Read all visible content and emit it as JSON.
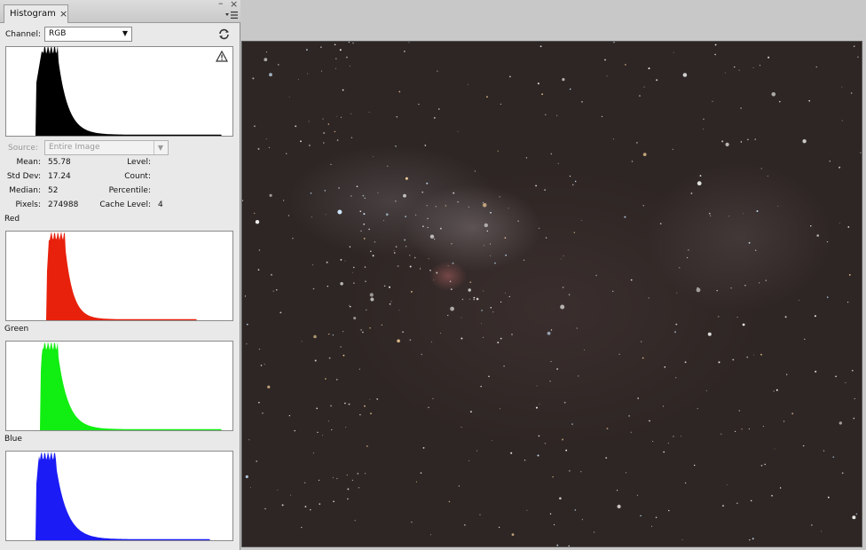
{
  "panel": {
    "tab_label": "Histogram",
    "close_glyph": "×",
    "minimize_glyph": "–",
    "window_close_glyph": "×",
    "menu_icon": "panel-menu-icon",
    "channel_label": "Channel:",
    "channel_value": "RGB",
    "refresh_icon": "refresh-icon",
    "warning_icon": "warning-icon",
    "source_label": "Source:",
    "source_value": "Entire Image",
    "stats": {
      "mean_label": "Mean:",
      "mean_value": "55.78",
      "stddev_label": "Std Dev:",
      "stddev_value": "17.24",
      "median_label": "Median:",
      "median_value": "52",
      "pixels_label": "Pixels:",
      "pixels_value": "274988",
      "level_label": "Level:",
      "count_label": "Count:",
      "percentile_label": "Percentile:",
      "cache_label": "Cache Level:",
      "cache_value": "4"
    },
    "channels": {
      "red_label": "Red",
      "green_label": "Green",
      "blue_label": "Blue"
    }
  },
  "colors": {
    "rgb": "#000000",
    "red": "#e8210c",
    "green": "#11ee11",
    "blue": "#1b1bf5",
    "panel_bg": "#e9e9e9"
  },
  "histograms": {
    "rgb": {
      "start": 0.13,
      "peak_pos": 0.16,
      "peak_end": 0.23,
      "decay": 0.045,
      "tail_end": 0.95,
      "peak": 1.0
    },
    "red": {
      "start": 0.18,
      "peak_pos": 0.19,
      "peak_end": 0.26,
      "decay": 0.035,
      "tail_end": 0.84,
      "peak": 0.98
    },
    "green": {
      "start": 0.15,
      "peak_pos": 0.16,
      "peak_end": 0.23,
      "decay": 0.045,
      "tail_end": 0.95,
      "peak": 0.98
    },
    "blue": {
      "start": 0.13,
      "peak_pos": 0.145,
      "peak_end": 0.22,
      "decay": 0.05,
      "tail_end": 0.9,
      "peak": 0.98
    }
  }
}
